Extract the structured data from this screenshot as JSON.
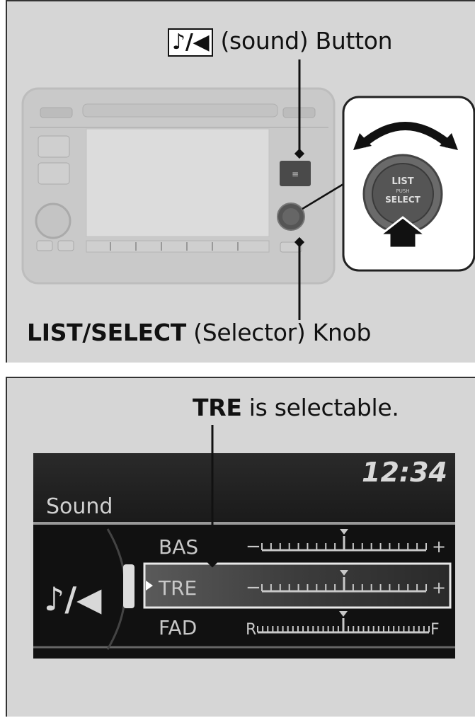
{
  "top_panel": {
    "sound_button_glyph": "♪/◀",
    "sound_button_label": "(sound) Button",
    "selector_bold": "LIST/SELECT",
    "selector_rest": "(Selector) Knob",
    "unit_button_text": "≡",
    "knob_text": [
      "LIST",
      "PUSH",
      "SELECT"
    ]
  },
  "bottom_panel": {
    "caption_bold": "TRE",
    "caption_rest": "is selectable.",
    "display": {
      "clock": "12:34",
      "title": "Sound",
      "rows": [
        {
          "name": "BAS",
          "left": "−",
          "right": "+"
        },
        {
          "name": "TRE",
          "left": "−",
          "right": "+"
        },
        {
          "name": "FAD",
          "left": "R",
          "right": "F"
        }
      ],
      "selected_row": "TRE"
    }
  }
}
